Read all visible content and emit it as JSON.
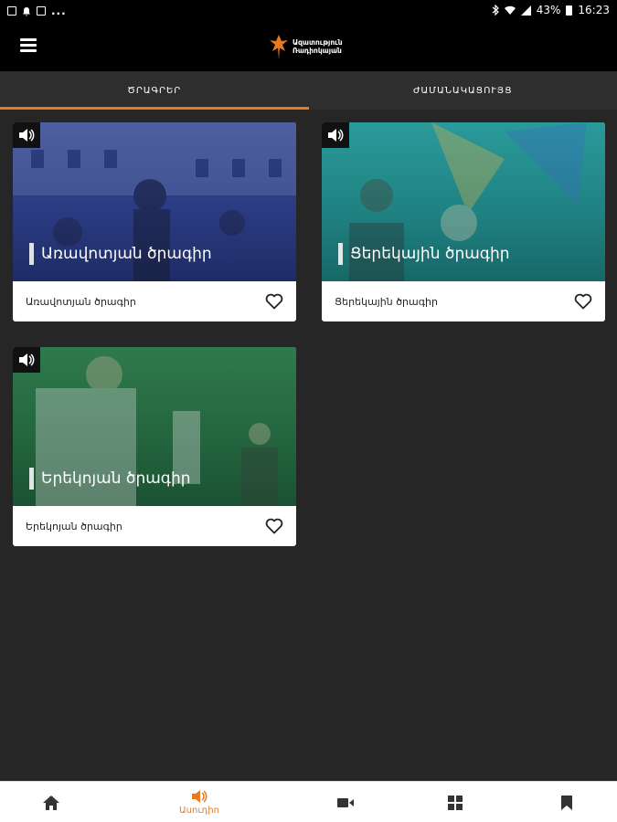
{
  "status_bar": {
    "battery": "43%",
    "time": "16:23"
  },
  "app": {
    "logo_line1": "Ազատություն",
    "logo_line2": "Ռադիոկայան"
  },
  "tabs": [
    {
      "label": "ԾՐԱԳՐԵՐ",
      "active": true
    },
    {
      "label": "ԺԱՄԱՆԱԿԱՑՈՒՅՑ",
      "active": false
    }
  ],
  "programs": [
    {
      "overlay_title": "Առավոտյան ծրագիր",
      "footer_label": "Առավոտյան ծրագիր",
      "tint": "#2a3f8a",
      "icon": "speaker-icon"
    },
    {
      "overlay_title": "Ցերեկային ծրագիր",
      "footer_label": "Ցերեկային ծրագիր",
      "tint": "#1f8a8a",
      "icon": "speaker-icon"
    },
    {
      "overlay_title": "Երեկոյան ծրագիր",
      "footer_label": "Երեկոյան ծրագիր",
      "tint": "#1e6b3c",
      "icon": "speaker-icon"
    }
  ],
  "bottom_nav": [
    {
      "icon": "home-icon",
      "label": ""
    },
    {
      "icon": "speaker-icon",
      "label": "Ասուդիո",
      "active": true
    },
    {
      "icon": "video-icon",
      "label": ""
    },
    {
      "icon": "grid-icon",
      "label": ""
    },
    {
      "icon": "bookmark-icon",
      "label": ""
    }
  ],
  "colors": {
    "accent": "#e8791f",
    "background": "#262626",
    "bar": "#000000"
  }
}
